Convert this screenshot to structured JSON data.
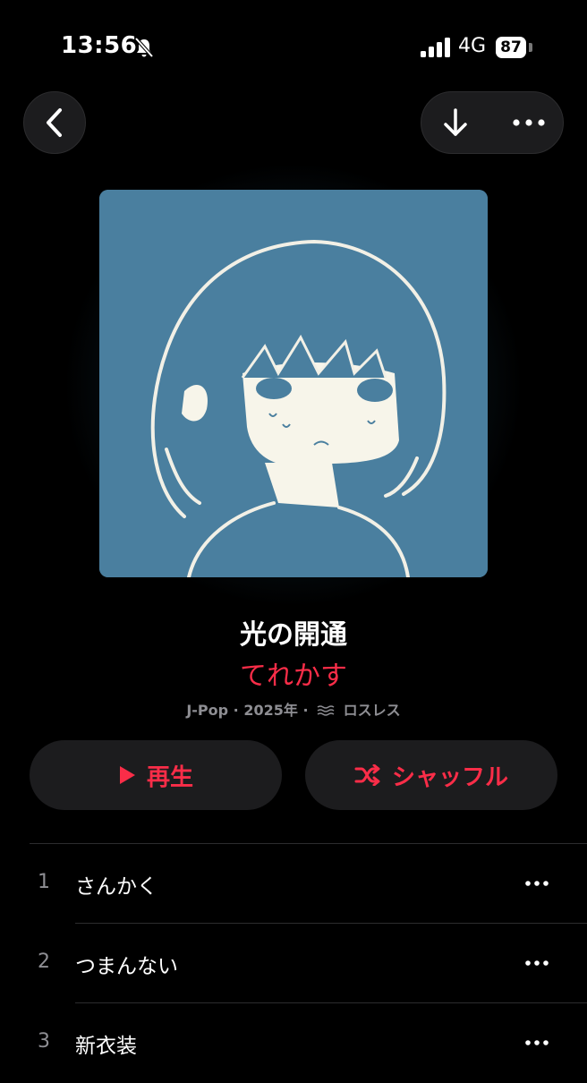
{
  "status_bar": {
    "time": "13:56",
    "network": "4G",
    "battery": "87"
  },
  "album": {
    "title": "光の開通",
    "artist": "てれかす",
    "genre": "J-Pop",
    "year": "2025年",
    "quality": "ロスレス",
    "separator": "·"
  },
  "actions": {
    "play_label": "再生",
    "shuffle_label": "シャッフル"
  },
  "tracks": [
    {
      "number": "1",
      "title": "さんかく"
    },
    {
      "number": "2",
      "title": "つまんない"
    },
    {
      "number": "3",
      "title": "新衣装"
    }
  ],
  "colors": {
    "accent": "#fa2d48",
    "background": "#000000",
    "surface": "#1c1c1e",
    "artwork_bg": "#4a7f9f"
  },
  "icons": [
    "bell-slash-icon",
    "signal-icon",
    "chevron-left-icon",
    "download-arrow-icon",
    "ellipsis-icon",
    "play-icon",
    "shuffle-icon",
    "lossless-icon"
  ]
}
